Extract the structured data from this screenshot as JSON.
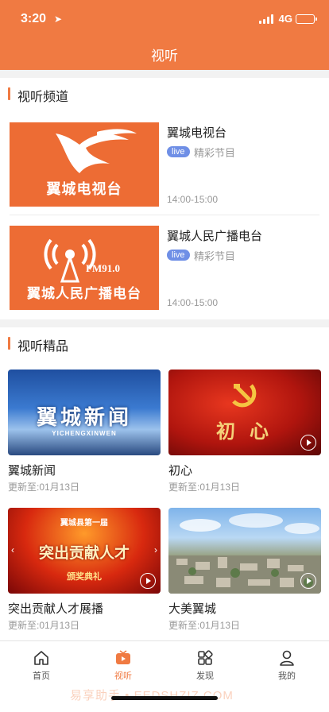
{
  "status": {
    "time": "3:20",
    "network": "4G"
  },
  "header": {
    "title": "视听"
  },
  "channels_section": {
    "title": "视听频道",
    "items": [
      {
        "name": "翼城电视台",
        "logo_text": "翼城电视台",
        "badge": "live",
        "subtitle": "精彩节目",
        "time": "14:00-15:00"
      },
      {
        "name": "翼城人民广播电台",
        "logo_text": "翼城人民广播电台",
        "freq": "FM91.0",
        "badge": "live",
        "subtitle": "精彩节目",
        "time": "14:00-15:00"
      }
    ]
  },
  "premium_section": {
    "title": "视听精品",
    "items": [
      {
        "title": "翼城新闻",
        "updated": "更新至:01月13日",
        "img_text": "翼城新闻",
        "img_sub": "YICHENGXINWEN"
      },
      {
        "title": "初心",
        "updated": "更新至:01月13日",
        "img_text": "初 心"
      },
      {
        "title": "突出贡献人才展播",
        "updated": "更新至:01月13日",
        "img_text": "突出贡献人才",
        "img_top": "翼城县第一届",
        "img_sub": "颁奖典礼"
      },
      {
        "title": "大美翼城",
        "updated": "更新至:01月13日"
      }
    ]
  },
  "tabbar": {
    "items": [
      {
        "label": "首页",
        "icon": "home-icon"
      },
      {
        "label": "视听",
        "icon": "tv-play-icon",
        "active": true
      },
      {
        "label": "发现",
        "icon": "discover-icon"
      },
      {
        "label": "我的",
        "icon": "user-icon"
      }
    ]
  },
  "watermark": "易享助手 • EEDSHZIZ.COM",
  "colors": {
    "accent": "#f07a42",
    "live": "#6f8fe6"
  }
}
